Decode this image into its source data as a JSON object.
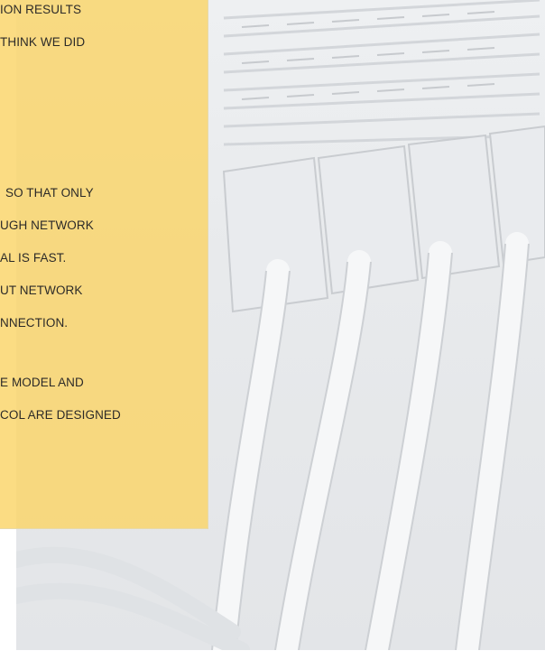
{
  "background": {
    "photo_subject": "network-switch-with-patch-cables",
    "tone": "#e8eaec"
  },
  "panel": {
    "color": "#f9d468",
    "lines": [
      "ION RESULTS",
      "THINK WE DID",
      "SO THAT ONLY",
      "UGH NETWORK",
      "AL IS FAST.",
      "UT NETWORK",
      "NNECTION.",
      "E MODEL AND",
      "COL ARE DESIGNED"
    ]
  }
}
